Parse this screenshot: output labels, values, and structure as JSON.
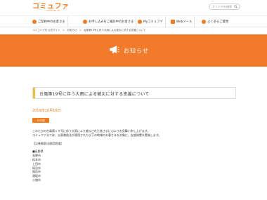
{
  "header": {
    "logo_text": "コミュファ",
    "logo_sub": "commufa ctc",
    "search_placeholder": "サイト内を検索"
  },
  "nav": {
    "items": [
      {
        "label": "ご契約中のお客さま"
      },
      {
        "label": "お申し込みをご検討中のお客さま"
      },
      {
        "label": "Myコミュファ"
      },
      {
        "label": "Webメール"
      },
      {
        "label": "よくあるご質問"
      }
    ]
  },
  "breadcrumb": [
    "コミュファ光 公式サイト",
    "＞",
    "お知らせ",
    "＞",
    "台風第19号に伴う大雨による被災に対する支援について"
  ],
  "banner": {
    "title": "お知らせ"
  },
  "article": {
    "title": "台風第19号に伴う大雨による被災に対する支援について",
    "date": "2019年10月16日",
    "category": "その他",
    "lines": [
      "このたびの台風第１９号に伴う大雨により被災された皆さまに心よりお見舞い申し上げます。",
      "コミュファ光では、災害救助法が適用された以下の地域のお客さまを対象に、支援措置を実施します。",
      "",
      "【災害救助法適用地域】",
      "",
      "■長野県",
      "長野市",
      "松本市",
      "上田市",
      "岡谷市",
      "諏訪市",
      "須坂市",
      "小諸市"
    ]
  },
  "colors": {
    "accent": "#f07b1d",
    "banner": "#f27b2b",
    "headline_bar": "#f2c02e"
  }
}
